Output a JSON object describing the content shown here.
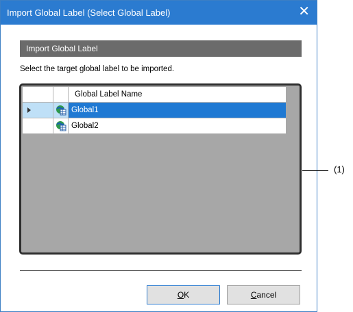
{
  "window": {
    "title": "Import Global Label (Select Global Label)",
    "close_glyph": "✕"
  },
  "section": {
    "header": "Import Global Label",
    "instruction": "Select the target global label to be imported."
  },
  "grid": {
    "column_header": "Global Label Name",
    "rows": [
      {
        "name": "Global1",
        "selected": true,
        "icon": "global-label-icon"
      },
      {
        "name": "Global2",
        "selected": false,
        "icon": "global-label-icon"
      }
    ]
  },
  "buttons": {
    "ok_mnemonic": "O",
    "ok_rest": "K",
    "cancel_mnemonic": "C",
    "cancel_rest": "ancel"
  },
  "callout": {
    "label": "(1)"
  },
  "colors": {
    "titlebar": "#2b7bd0",
    "selection": "#1f79d3",
    "section_header": "#6b6b6b",
    "grid_background": "#a7a7a7"
  }
}
